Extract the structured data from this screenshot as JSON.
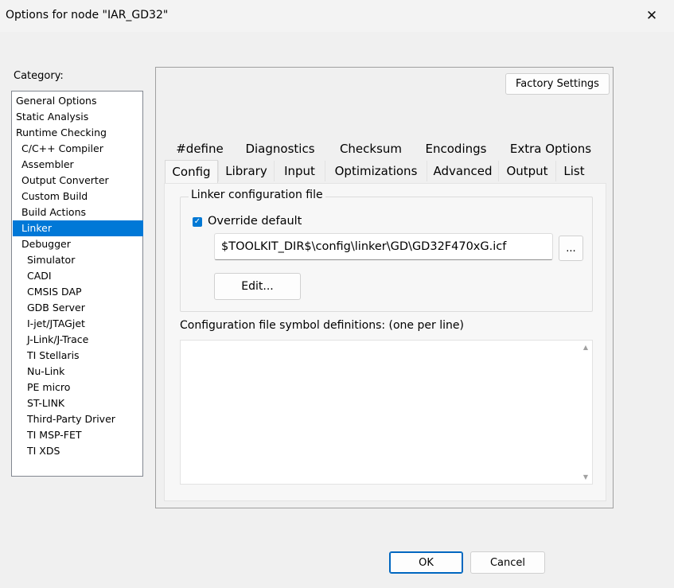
{
  "window": {
    "title": "Options for node \"IAR_GD32\"",
    "close_glyph": "✕"
  },
  "category": {
    "label": "Category:",
    "selected": "Linker",
    "items": [
      {
        "label": "General Options"
      },
      {
        "label": "Static Analysis"
      },
      {
        "label": "Runtime Checking"
      },
      {
        "label": "C/C++ Compiler"
      },
      {
        "label": "Assembler"
      },
      {
        "label": "Output Converter"
      },
      {
        "label": "Custom Build"
      },
      {
        "label": "Build Actions"
      },
      {
        "label": "Linker"
      },
      {
        "label": "Debugger"
      },
      {
        "label": "Simulator"
      },
      {
        "label": "CADI"
      },
      {
        "label": "CMSIS DAP"
      },
      {
        "label": "GDB Server"
      },
      {
        "label": "I-jet/JTAGjet"
      },
      {
        "label": "J-Link/J-Trace"
      },
      {
        "label": "TI Stellaris"
      },
      {
        "label": "Nu-Link"
      },
      {
        "label": "PE micro"
      },
      {
        "label": "ST-LINK"
      },
      {
        "label": "Third-Party Driver"
      },
      {
        "label": "TI MSP-FET"
      },
      {
        "label": "TI XDS"
      }
    ]
  },
  "panel": {
    "factory_settings": "Factory Settings",
    "tabs_row1": [
      "#define",
      "Diagnostics",
      "Checksum",
      "Encodings",
      "Extra Options"
    ],
    "tabs_row2": [
      "Config",
      "Library",
      "Input",
      "Optimizations",
      "Advanced",
      "Output",
      "List"
    ],
    "active_tab": "Config"
  },
  "config": {
    "group_label": "Linker configuration file",
    "override_label": "Override default",
    "override_checked": true,
    "check_glyph": "✓",
    "path_value": "$TOOLKIT_DIR$\\config\\linker\\GD\\GD32F470xG.icf",
    "browse_label": "...",
    "edit_label": "Edit...",
    "symbols_label": "Configuration file symbol definitions: (one per line)",
    "symbols_value": "",
    "scroll_up_glyph": "▲",
    "scroll_down_glyph": "▼"
  },
  "footer": {
    "ok_label": "OK",
    "cancel_label": "Cancel"
  },
  "colors": {
    "selection": "#0078d7",
    "checkbox": "#0078d4",
    "ok_border": "#0067c0"
  }
}
